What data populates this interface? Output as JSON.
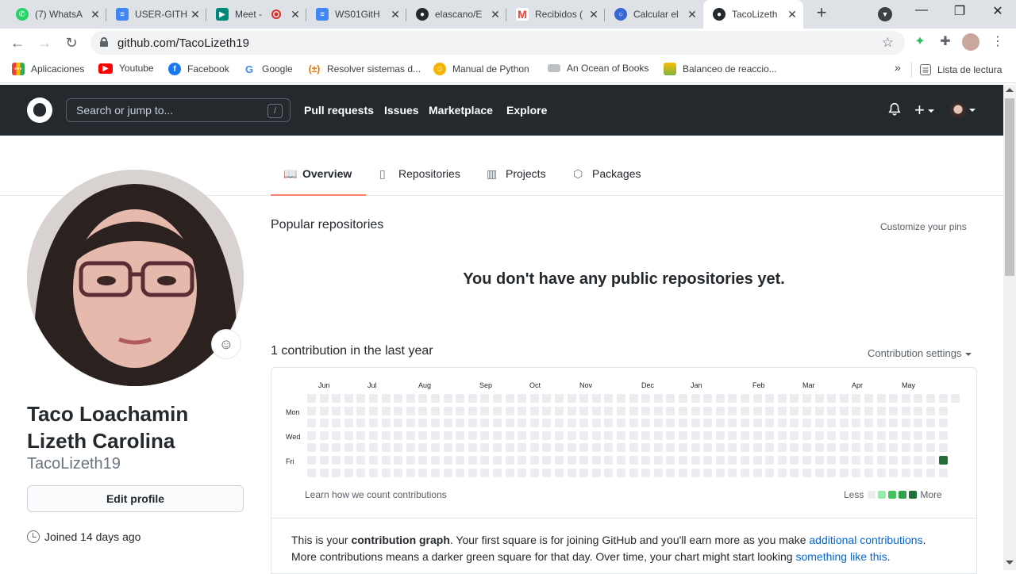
{
  "browser": {
    "tabs": [
      {
        "label": "(7) WhatsA",
        "icon": "whatsapp-icon",
        "color": "#25d366"
      },
      {
        "label": "USER-GITH",
        "icon": "docs-icon",
        "color": "#4285f4"
      },
      {
        "label": "Meet -",
        "icon": "meet-icon",
        "color": "#00897b"
      },
      {
        "label": "WS01GitH",
        "icon": "docs-icon",
        "color": "#4285f4"
      },
      {
        "label": "elascano/E",
        "icon": "github-icon",
        "color": "#24292e"
      },
      {
        "label": "Recibidos (",
        "icon": "gmail-icon",
        "color": "#ea4335"
      },
      {
        "label": "Calcular el",
        "icon": "calculator-icon",
        "color": "#3367d6"
      },
      {
        "label": "TacoLizeth",
        "icon": "github-icon",
        "color": "#24292e"
      }
    ],
    "new_tab": "+",
    "url": "github.com/TacoLizeth19",
    "bookmarks": [
      {
        "label": "Aplicaciones",
        "icon": "apps-grid-icon",
        "color": "#ea4335"
      },
      {
        "label": "Youtube",
        "icon": "youtube-icon",
        "color": "#ff0000"
      },
      {
        "label": "Facebook",
        "icon": "facebook-icon",
        "color": "#1877f2"
      },
      {
        "label": "Google",
        "icon": "google-icon",
        "color": "#4285f4"
      },
      {
        "label": "Resolver sistemas d...",
        "icon": "calculator-icon",
        "color": "#e37400"
      },
      {
        "label": "Manual de Python",
        "icon": "python-icon",
        "color": "#f4b400"
      },
      {
        "label": "An Ocean of Books",
        "icon": "book-icon",
        "color": "#9aa0a6"
      },
      {
        "label": "Balanceo de reaccio...",
        "icon": "chemistry-icon",
        "color": "#7cb342"
      }
    ],
    "bookmarks_more": "»",
    "reading_list": "Lista de lectura"
  },
  "github": {
    "search_placeholder": "Search or jump to...",
    "search_key": "/",
    "nav": [
      "Pull requests",
      "Issues",
      "Marketplace",
      "Explore"
    ],
    "plus": "+"
  },
  "profile": {
    "tabs": [
      "Overview",
      "Repositories",
      "Projects",
      "Packages"
    ],
    "name": "Taco Loachamin Lizeth Carolina",
    "username": "TacoLizeth19",
    "edit_profile": "Edit profile",
    "joined": "Joined 14 days ago"
  },
  "main": {
    "popular_title": "Popular repositories",
    "customize_pins": "Customize your pins",
    "no_repos": "You don't have any public repositories yet.",
    "contrib_title": "1 contribution in the last year",
    "contrib_settings": "Contribution settings",
    "months": [
      "Jun",
      "Jul",
      "Aug",
      "Sep",
      "Oct",
      "Nov",
      "Dec",
      "Jan",
      "Feb",
      "Mar",
      "Apr",
      "May"
    ],
    "days": [
      "Mon",
      "Wed",
      "Fri"
    ],
    "learn": "Learn how we count contributions",
    "legend_less": "Less",
    "legend_more": "More",
    "legend_colors": [
      "#ebedf0",
      "#9be9a8",
      "#40c463",
      "#30a14e",
      "#216e39"
    ],
    "contribution_week": 51,
    "contribution_day": 5,
    "contribution_color": "#216e39",
    "weeks": 53,
    "explain_1_pre": "This is your ",
    "explain_1_bold": "contribution graph",
    "explain_1_mid": ". Your first square is for joining GitHub and you'll earn more as you make ",
    "explain_1_link": "additional contributions",
    "explain_1_end": ".",
    "explain_2_pre": "More contributions means a darker green square for that day. Over time, your chart might start looking ",
    "explain_2_link": "something like this",
    "explain_2_end": "."
  }
}
